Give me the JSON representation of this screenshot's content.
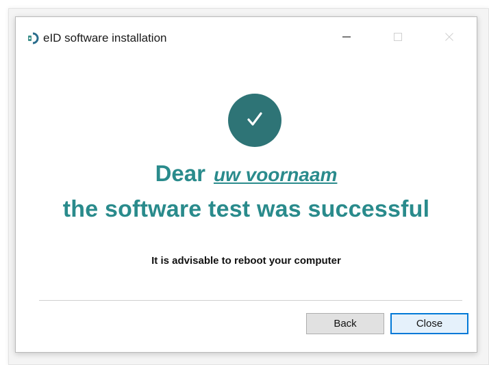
{
  "window": {
    "title": "eID software installation",
    "icon": "eid-card-icon"
  },
  "titlebar_controls": {
    "minimize_icon": "minimize-icon",
    "maximize_icon": "maximize-icon",
    "close_icon": "close-icon"
  },
  "content": {
    "status_icon": "checkmark-icon",
    "greeting_prefix": "Dear",
    "user_name": "uw voornaam",
    "success_message": "the software test was successful",
    "advice": "It is advisable to reboot your computer"
  },
  "buttons": {
    "back_label": "Back",
    "close_label": "Close"
  },
  "colors": {
    "accent": "#2a8b8c",
    "check_circle": "#2e7476",
    "focus_border": "#0078d7"
  }
}
